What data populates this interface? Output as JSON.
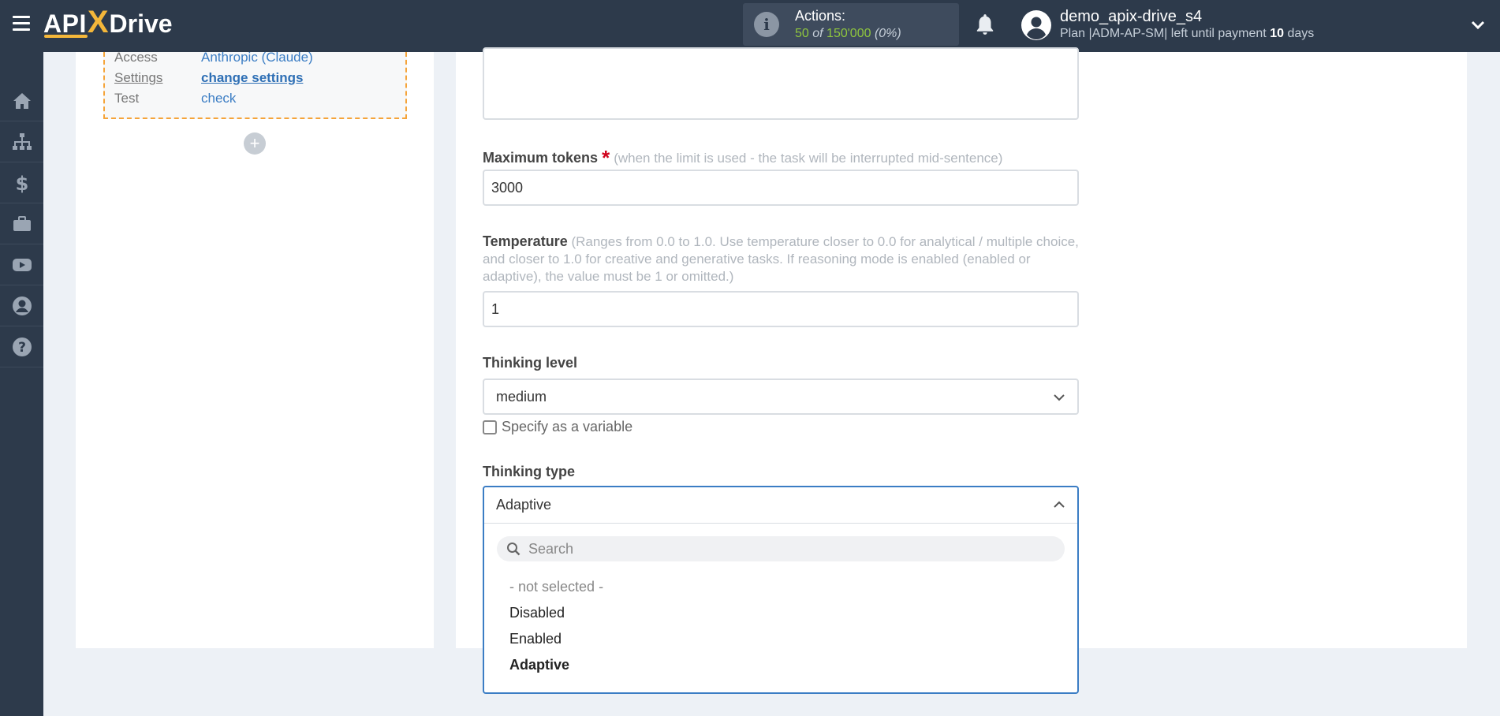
{
  "brand": {
    "api": "API",
    "x": "X",
    "drive": "Drive"
  },
  "header": {
    "actions_label": "Actions:",
    "actions_used": "50",
    "actions_of": "of",
    "actions_total": "150'000",
    "actions_percent": "(0%)",
    "user_name": "demo_apix-drive_s4",
    "plan_prefix": "Plan |ADM-AP-SM| left until payment",
    "plan_days": "10",
    "plan_suffix": "days"
  },
  "sidebar": {
    "items": [
      "home-icon",
      "sitemap-icon",
      "dollar-icon",
      "briefcase-icon",
      "youtube-icon",
      "user-icon",
      "help-icon"
    ]
  },
  "step": {
    "rows": [
      {
        "key": "Access",
        "value": "Anthropic (Claude)"
      },
      {
        "key": "Settings",
        "value": "change settings"
      },
      {
        "key": "Test",
        "value": "check"
      }
    ],
    "add_label": "+"
  },
  "form": {
    "max_tokens": {
      "label": "Maximum tokens",
      "required": "*",
      "hint": "(when the limit is used - the task will be interrupted mid-sentence)",
      "value": "3000"
    },
    "temperature": {
      "label": "Temperature",
      "hint": "(Ranges from 0.0 to 1.0. Use temperature closer to 0.0 for analytical / multiple choice, and closer to 1.0 for creative and generative tasks. If reasoning mode is enabled (enabled or adaptive), the value must be 1 or omitted.)",
      "value": "1"
    },
    "thinking_level": {
      "label": "Thinking level",
      "value": "medium",
      "variable_label": "Specify as a variable"
    },
    "thinking_type": {
      "label": "Thinking type",
      "value": "Adaptive",
      "search_placeholder": "Search",
      "options": [
        "- not selected -",
        "Disabled",
        "Enabled",
        "Adaptive"
      ]
    }
  },
  "colors": {
    "topbar": "#2d3a4b",
    "accent": "#3b7dc4",
    "brand_yellow": "#f4b73a",
    "dashed_border": "#f5a43a",
    "required": "#d0021b"
  }
}
